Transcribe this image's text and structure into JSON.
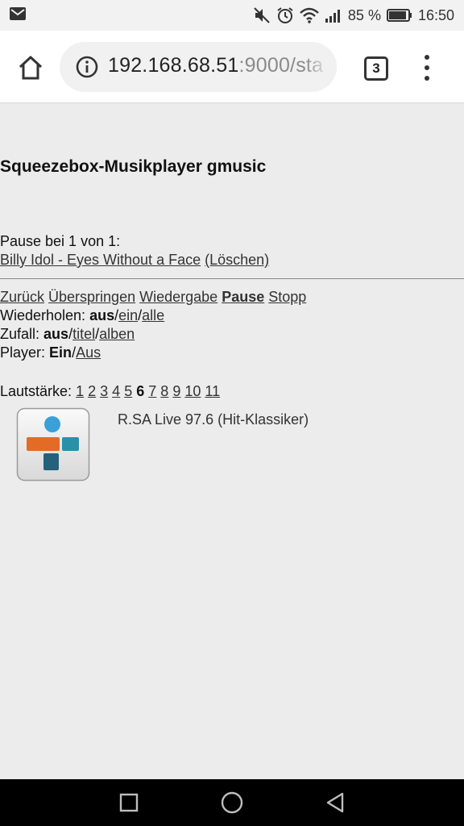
{
  "status_bar": {
    "battery_percent": "85 %",
    "time": "16:50",
    "icons": [
      "mail-icon",
      "mute-icon",
      "alarm-icon",
      "wifi-icon",
      "signal-icon",
      "battery-icon"
    ]
  },
  "browser": {
    "url_host": "192.168.68.51",
    "url_rest": ":9000/sta",
    "tab_count": "3"
  },
  "page": {
    "title": "Squeezebox-Musikplayer gmusic",
    "status_line": "Pause bei 1 von 1:",
    "track": "Billy Idol - Eyes Without a Face",
    "delete_link": "(Löschen)",
    "controls": {
      "back": "Zurück",
      "skip": "Überspringen",
      "play": "Wiedergabe",
      "pause": "Pause",
      "stop": "Stopp"
    },
    "repeat": {
      "label": "Wiederholen:",
      "off": "aus",
      "one": "ein",
      "all": "alle"
    },
    "shuffle": {
      "label": "Zufall:",
      "off": "aus",
      "title": "titel",
      "albums": "alben"
    },
    "player": {
      "label": "Player:",
      "on": "Ein",
      "off": "Aus"
    },
    "volume": {
      "label": "Lautstärke:",
      "levels": [
        "1",
        "2",
        "3",
        "4",
        "5",
        "6",
        "7",
        "8",
        "9",
        "10",
        "11"
      ],
      "current": "6"
    },
    "station": "R.SA Live 97.6 (Hit-Klassiker)"
  },
  "colors": {
    "page_bg": "#ececec",
    "tunein_blue": "#3aa0d8",
    "tunein_orange": "#e36b25",
    "tunein_teal": "#2b8fa8",
    "tunein_darkteal": "#25617a"
  }
}
